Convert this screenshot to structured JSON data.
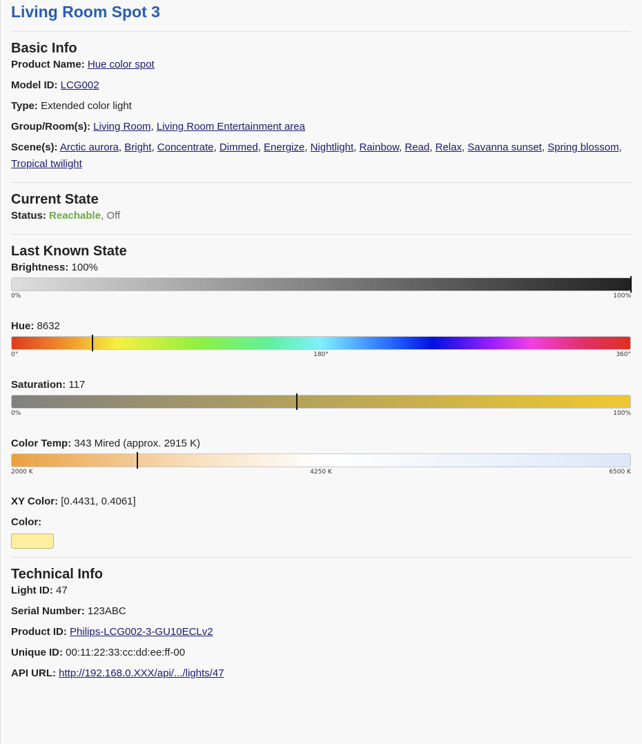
{
  "title": "Living Room Spot 3",
  "basic": {
    "heading": "Basic Info",
    "product_name_label": "Product Name:",
    "product_name": "Hue color spot",
    "model_id_label": "Model ID:",
    "model_id": "LCG002",
    "type_label": "Type:",
    "type": "Extended color light",
    "groups_label": "Group/Room(s):",
    "groups": [
      "Living Room",
      "Living Room Entertainment area"
    ],
    "scenes_label": "Scene(s):",
    "scenes": [
      "Arctic aurora",
      "Bright",
      "Concentrate",
      "Dimmed",
      "Energize",
      "Nightlight",
      "Rainbow",
      "Read",
      "Relax",
      "Savanna sunset",
      "Spring blossom",
      "Tropical twilight"
    ]
  },
  "current": {
    "heading": "Current State",
    "status_label": "Status:",
    "reachable": "Reachable",
    "power": "Off",
    "reachable_color": "#6aaa45"
  },
  "last": {
    "heading": "Last Known State",
    "brightness_label": "Brightness:",
    "brightness_value": "100%",
    "brightness_fraction": 1.0,
    "brightness_scale": [
      "0%",
      "100%"
    ],
    "hue_label": "Hue:",
    "hue_value": "8632",
    "hue_fraction": 0.1317,
    "hue_scale": [
      "0°",
      "180°",
      "360°"
    ],
    "saturation_label": "Saturation:",
    "saturation_value": "117",
    "saturation_fraction": 0.4606,
    "saturation_scale": [
      "0%",
      "100%"
    ],
    "ct_label": "Color Temp:",
    "ct_value": "343 Mired (approx. 2915 K)",
    "ct_fraction": 0.2033,
    "ct_scale": [
      "2000 K",
      "4250 K",
      "6500 K"
    ],
    "xy_label": "XY Color:",
    "xy_value": "[0.4431, 0.4061]",
    "color_label": "Color:",
    "swatch_color": "#fcf0a0"
  },
  "tech": {
    "heading": "Technical Info",
    "light_id_label": "Light ID:",
    "light_id": "47",
    "serial_label": "Serial Number:",
    "serial": "123ABC",
    "product_id_label": "Product ID:",
    "product_id": "Philips-LCG002-3-GU10ECLv2",
    "unique_id_label": "Unique ID:",
    "unique_id": "00:11:22:33:cc:dd:ee:ff-00",
    "api_url_label": "API URL:",
    "api_url": "http://192.168.0.XXX/api/.../lights/47"
  }
}
